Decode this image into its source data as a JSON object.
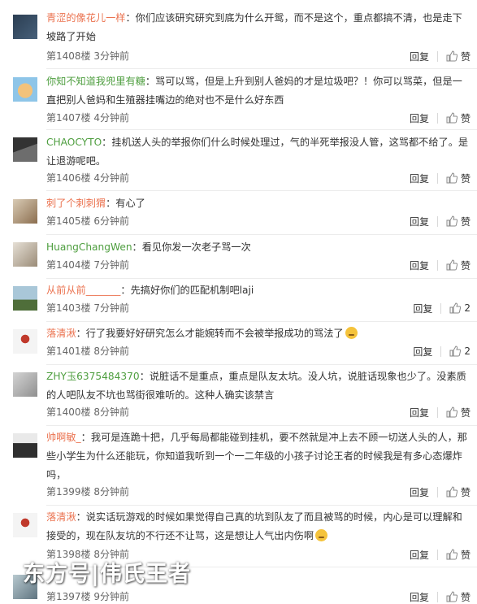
{
  "ui": {
    "reply_label": "回复",
    "like_icon": "thumbs-up-icon"
  },
  "comments": [
    {
      "user": "青涩的像花儿一样",
      "text": "：你们应该研究研究到底为什么开鸳，而不是这个，重点都搞不清，也是走下坡路了开始",
      "floor": "第1408楼",
      "time": "3分钟前",
      "like_label": "赞"
    },
    {
      "user": "你知不知道我兜里有糖",
      "text": "：骂可以骂，但是上升到别人爸妈的才是垃圾吧？！你可以骂菜，但是一直把别人爸妈和生殖器挂嘴边的绝对也不是什么好东西",
      "floor": "第1407楼",
      "time": "4分钟前",
      "like_label": "赞"
    },
    {
      "user": "CHAOCYTO",
      "text": "：挂机送人头的举报你们什么时候处理过，气的半死举报没人管，这骂都不给了。是让退游呢吧。",
      "floor": "第1406楼",
      "time": "4分钟前",
      "like_label": "赞"
    },
    {
      "user": "刺了个刺刺猬",
      "text": "：有心了",
      "floor": "第1405楼",
      "time": "6分钟前",
      "like_label": "赞"
    },
    {
      "user": "HuangChangWen",
      "text": "：看见你发一次老子骂一次",
      "floor": "第1404楼",
      "time": "7分钟前",
      "like_label": "赞"
    },
    {
      "user": "从前从前_______",
      "text": "：先搞好你们的匹配机制吧laji",
      "floor": "第1403楼",
      "time": "7分钟前",
      "like_label": "2"
    },
    {
      "user": "落清湫",
      "text": "：行了我要好好研究怎么才能婉转而不会被举报成功的骂法了",
      "emoji": true,
      "floor": "第1401楼",
      "time": "8分钟前",
      "like_label": "2"
    },
    {
      "user": "ZHY玉6375484370",
      "text": "：说脏话不是重点，重点是队友太坑。没人坑，说脏话现象也少了。没素质的人吧队友不坑也骂街很难听的。这种人确实该禁言",
      "floor": "第1400楼",
      "time": "8分钟前",
      "like_label": "赞"
    },
    {
      "user": "帅啊敏_",
      "text": "：我可是连跪十把，几乎每局都能碰到挂机，要不然就是冲上去不顾一切送人头的人，那些小学生为什么还能玩，你知道我听到一个一二年级的小孩子讨论王者的时候我是有多心态爆炸吗，",
      "floor": "第1399楼",
      "time": "8分钟前",
      "like_label": "赞"
    },
    {
      "user": "落清湫",
      "text": "：说实话玩游戏的时候如果觉得自己真的坑到队友了而且被骂的时候，内心是可以理解和接受的，现在队友坑的不行还不让骂，这是想让人气出内伤啊",
      "emoji": true,
      "floor": "第1398楼",
      "time": "8分钟前",
      "like_label": "赞"
    },
    {
      "user": "",
      "text": "",
      "floor": "第1397楼",
      "time": "9分钟前",
      "like_label": "赞"
    }
  ],
  "watermark": "东方号|伟氏王者"
}
